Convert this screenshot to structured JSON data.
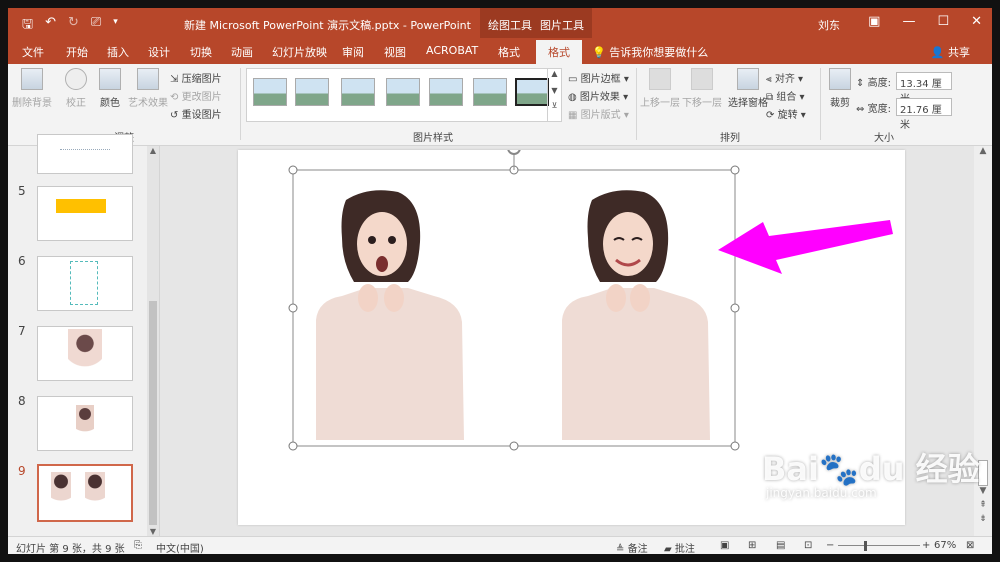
{
  "titlebar": {
    "title": "新建 Microsoft PowerPoint 演示文稿.pptx  -  PowerPoint",
    "ctx_draw": "绘图工具",
    "ctx_picture": "图片工具",
    "user": "刘东",
    "bg": "#b7472a"
  },
  "tabs": [
    "文件",
    "开始",
    "插入",
    "设计",
    "切换",
    "动画",
    "幻灯片放映",
    "审阅",
    "视图",
    "ACROBAT",
    "格式",
    "格式"
  ],
  "tell_me": "告诉我你想要做什么",
  "share": "共享",
  "ribbon": {
    "adjust": {
      "remove_bg": "删除背景",
      "corrections": "校正",
      "color": "颜色",
      "artistic": "艺术效果",
      "compress": "压缩图片",
      "change": "更改图片",
      "reset": "重设图片",
      "label": "调整"
    },
    "styles": {
      "border": "图片边框",
      "effects": "图片效果",
      "layout": "图片版式",
      "label": "图片样式"
    },
    "arrange": {
      "forward": "上移一层",
      "backward": "下移一层",
      "selection_pane": "选择窗格",
      "align": "对齐",
      "group": "组合",
      "rotate": "旋转",
      "label": "排列"
    },
    "size": {
      "crop": "裁剪",
      "height_label": "高度:",
      "height_value": "13.34 厘米",
      "width_label": "宽度:",
      "width_value": "21.76 厘米",
      "label": "大小"
    }
  },
  "slides": [
    "5",
    "6",
    "7",
    "8",
    "9"
  ],
  "status": {
    "slide_info": "幻灯片 第 9 张，共 9 张",
    "language": "中文(中国)",
    "notes": "备注",
    "comments": "批注",
    "zoom": "67%"
  },
  "watermark": {
    "brand": "Bai",
    "brand_tail": "du",
    "cn": "经验",
    "url": "jingyan.baidu.com"
  },
  "colors": {
    "accent": "#b7472a",
    "arrow": "#ff00ff",
    "slide_bar": "#ffc000"
  }
}
